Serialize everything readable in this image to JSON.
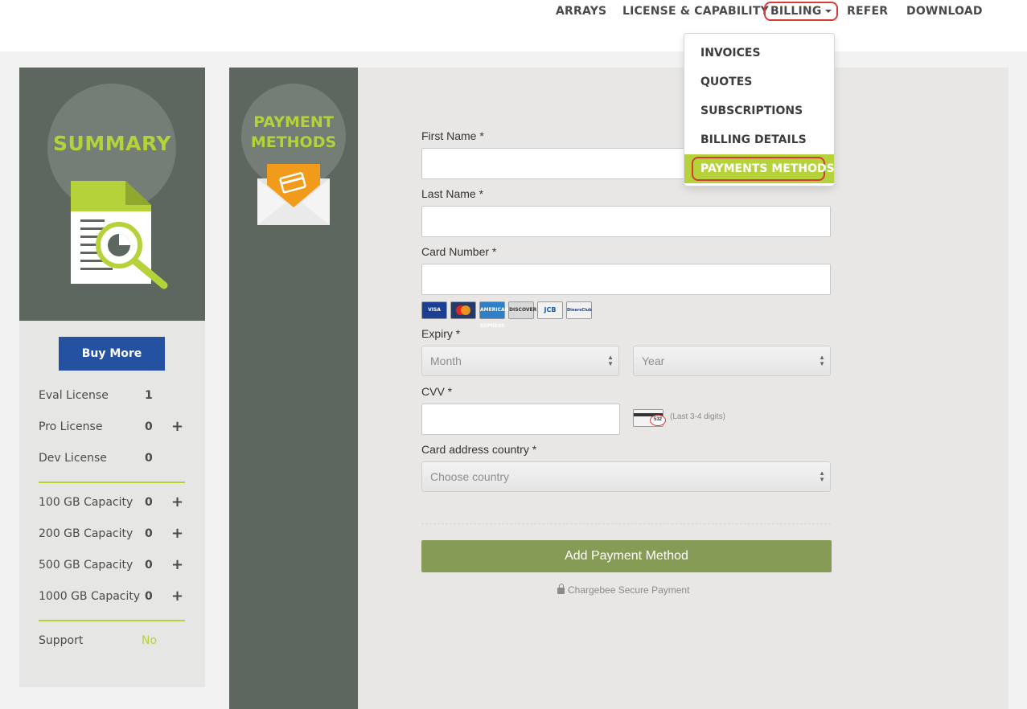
{
  "nav": {
    "arrays": "ARRAYS",
    "license": "LICENSE & CAPABILITY",
    "billing": "BILLING",
    "refer": "REFER",
    "download": "DOWNLOAD"
  },
  "billing_menu": {
    "items": [
      "INVOICES",
      "QUOTES",
      "SUBSCRIPTIONS",
      "BILLING DETAILS"
    ],
    "active": "PAYMENTS METHODS"
  },
  "summary": {
    "title": "SUMMARY",
    "buy_more": "Buy More",
    "licenses": [
      {
        "label": "Eval License",
        "value": "1",
        "plus": ""
      },
      {
        "label": "Pro License",
        "value": "0",
        "plus": "+"
      },
      {
        "label": "Dev License",
        "value": "0",
        "plus": ""
      }
    ],
    "capacities": [
      {
        "label": "100 GB Capacity",
        "value": "0",
        "plus": "+"
      },
      {
        "label": "200 GB Capacity",
        "value": "0",
        "plus": "+"
      },
      {
        "label": "500 GB Capacity",
        "value": "0",
        "plus": "+"
      },
      {
        "label": "1000 GB Capacity",
        "value": "0",
        "plus": "+"
      }
    ],
    "support": {
      "label": "Support",
      "value": "No"
    }
  },
  "payment_section": {
    "title_line1": "PAYMENT",
    "title_line2": "METHODS"
  },
  "form": {
    "first_name_label": "First Name *",
    "last_name_label": "Last Name *",
    "card_number_label": "Card Number *",
    "expiry_label": "Expiry *",
    "month_placeholder": "Month",
    "year_placeholder": "Year",
    "cvv_label": "CVV *",
    "cvv_hint": "(Last 3-4 digits)",
    "cvv_sample": "532",
    "country_label": "Card address country *",
    "country_placeholder": "Choose country",
    "submit": "Add Payment Method",
    "secure_note": "Chargebee Secure Payment",
    "card_brands": [
      "VISA",
      "MasterCard",
      "AMERICAN EXPRESS",
      "DISCOVER",
      "JCB",
      "DinersClub"
    ]
  },
  "colors": {
    "accent_green": "#b5d23a",
    "panel_dark": "#5d6760",
    "button_blue": "#2452a1",
    "submit_green": "#859b56",
    "highlight_red": "#d83a3a"
  }
}
